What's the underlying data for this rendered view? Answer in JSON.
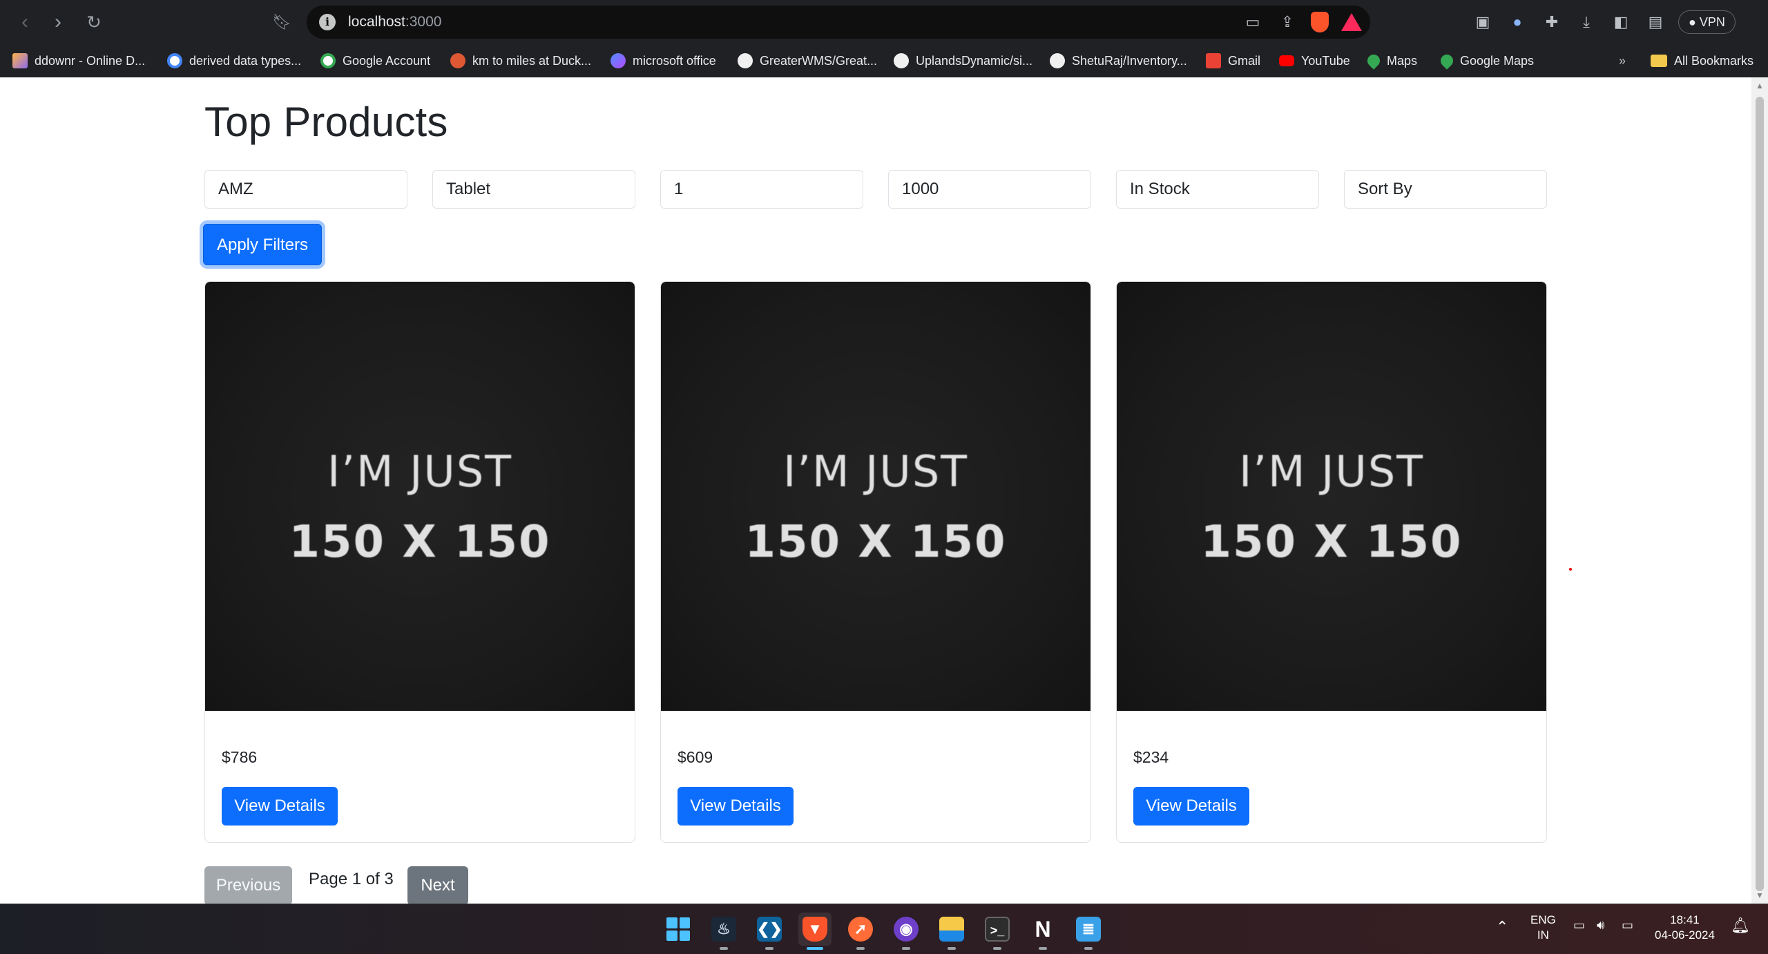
{
  "browser": {
    "url_host": "localhost",
    "url_port": ":3000",
    "vpn_label": "VPN",
    "bookmarks": [
      {
        "label": "ddownr - Online D...",
        "color": "#8e6cf0"
      },
      {
        "label": "derived data types...",
        "color": "#ffffff"
      },
      {
        "label": "Google Account",
        "color": "#ffffff"
      },
      {
        "label": "km to miles at Duck...",
        "color": "#de5833"
      },
      {
        "label": "microsoft office",
        "color": "#7b61ff"
      },
      {
        "label": "GreaterWMS/Great...",
        "color": "#f0f0f0"
      },
      {
        "label": "UplandsDynamic/si...",
        "color": "#f0f0f0"
      },
      {
        "label": "ShetuRaj/Inventory...",
        "color": "#f0f0f0"
      },
      {
        "label": "Gmail",
        "color": "#ea4335"
      },
      {
        "label": "YouTube",
        "color": "#ff0000"
      },
      {
        "label": "Maps",
        "color": "#34a853"
      },
      {
        "label": "Google Maps",
        "color": "#34a853"
      }
    ],
    "overflow_label": "»",
    "all_bookmarks_label": "All Bookmarks"
  },
  "page": {
    "title": "Top Products",
    "filters": {
      "company": "AMZ",
      "category": "Tablet",
      "min_price": "1",
      "max_price": "1000",
      "availability": "In Stock",
      "sort": "Sort By"
    },
    "apply_label": "Apply Filters",
    "products": [
      {
        "image_line1": "I’M JUST",
        "image_line2": "150 X 150",
        "price": "$786",
        "button": "View Details"
      },
      {
        "image_line1": "I’M JUST",
        "image_line2": "150 X 150",
        "price": "$609",
        "button": "View Details"
      },
      {
        "image_line1": "I’M JUST",
        "image_line2": "150 X 150",
        "price": "$234",
        "button": "View Details"
      }
    ],
    "pagination": {
      "previous": "Previous",
      "info": "Page 1 of 3",
      "next": "Next"
    }
  },
  "taskbar": {
    "apps": [
      "start-icon",
      "steam-icon",
      "vscode-icon",
      "brave-icon",
      "postman-icon",
      "github-desktop-icon",
      "file-explorer-icon",
      "terminal-icon",
      "notion-icon",
      "notepad-icon"
    ],
    "lang_line1": "ENG",
    "lang_line2": "IN",
    "time": "18:41",
    "date": "04-06-2024"
  },
  "colors": {
    "primary": "#0d6efd",
    "secondary": "#6c757d",
    "disabled": "#a3a8ad",
    "chrome": "#202124"
  }
}
